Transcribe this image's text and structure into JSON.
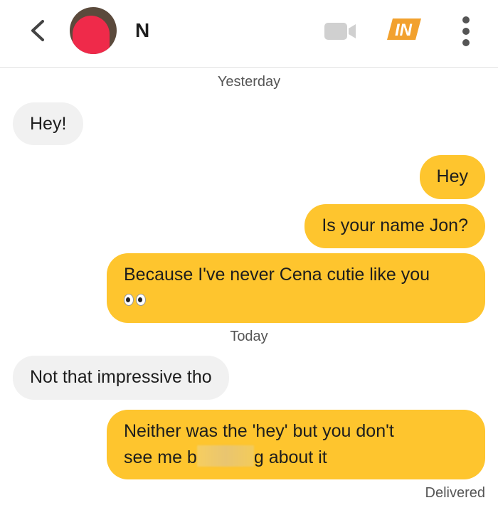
{
  "header": {
    "contact_name": "N",
    "badge_text": "IN",
    "icons": {
      "back": "chevron-left-icon",
      "video": "video-camera-icon",
      "badge": "in-badge-icon",
      "menu": "more-vertical-icon"
    },
    "colors": {
      "accent": "#fec52e",
      "badge": "#f2a12e",
      "redaction": "#ef2a4a"
    }
  },
  "conversation": {
    "stamp_yesterday": "Yesterday",
    "stamp_today": "Today",
    "messages": [
      {
        "from": "them",
        "text": "Hey!"
      },
      {
        "from": "me",
        "text": "Hey"
      },
      {
        "from": "me",
        "text": "Is your name Jon?"
      },
      {
        "from": "me",
        "text": "Because I've never Cena cutie like you",
        "emoji": "eyes"
      },
      {
        "from": "them",
        "text": "Not that impressive tho"
      },
      {
        "from": "me",
        "line1": "Neither was the 'hey' but you don't",
        "line2_start": "see me b",
        "line2_end": "g about it",
        "redacted": true
      }
    ],
    "status": "Delivered"
  }
}
